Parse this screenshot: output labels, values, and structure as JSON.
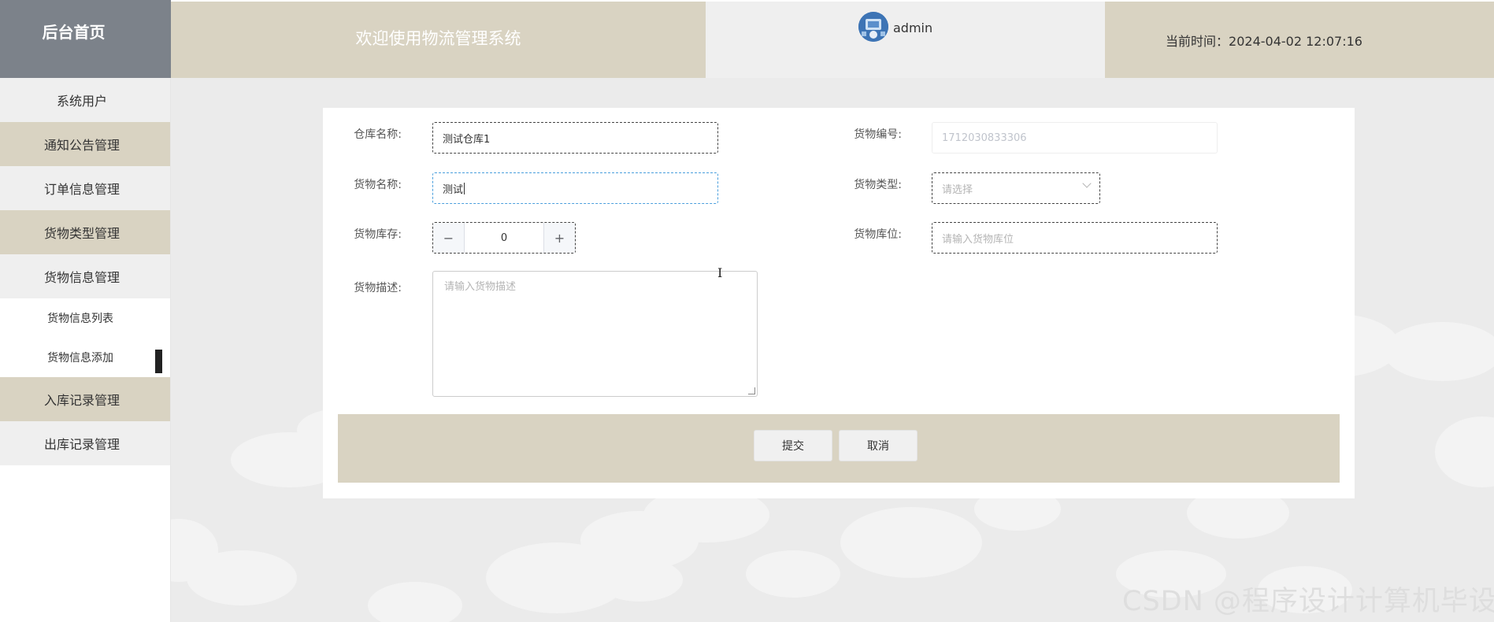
{
  "header": {
    "brand": "后台首页",
    "welcome": "欢迎使用物流管理系统",
    "username": "admin",
    "time": "当前时间：2024-04-02 12:07:16"
  },
  "sidebar": {
    "items": [
      {
        "label": "系统用户"
      },
      {
        "label": "通知公告管理"
      },
      {
        "label": "订单信息管理"
      },
      {
        "label": "货物类型管理"
      },
      {
        "label": "货物信息管理"
      }
    ],
    "subitems": [
      {
        "label": "货物信息列表"
      },
      {
        "label": "货物信息添加"
      }
    ],
    "items_after": [
      {
        "label": "入库记录管理"
      },
      {
        "label": "出库记录管理"
      }
    ]
  },
  "form": {
    "warehouse_name": {
      "label": "仓库名称:",
      "value": "测试仓库1"
    },
    "goods_name": {
      "label": "货物名称:",
      "value": "测试"
    },
    "stock": {
      "label": "货物库存:",
      "value": "0",
      "minus": "−",
      "plus": "+"
    },
    "description": {
      "label": "货物描述:",
      "placeholder": "请输入货物描述"
    },
    "goods_code": {
      "label": "货物编号:",
      "value": "1712030833306"
    },
    "goods_type": {
      "label": "货物类型:",
      "placeholder": "请选择"
    },
    "location": {
      "label": "货物库位:",
      "placeholder": "请输入货物库位"
    },
    "submit_label": "提交",
    "cancel_label": "取消"
  },
  "watermark": "CSDN @程序设计计算机毕设"
}
